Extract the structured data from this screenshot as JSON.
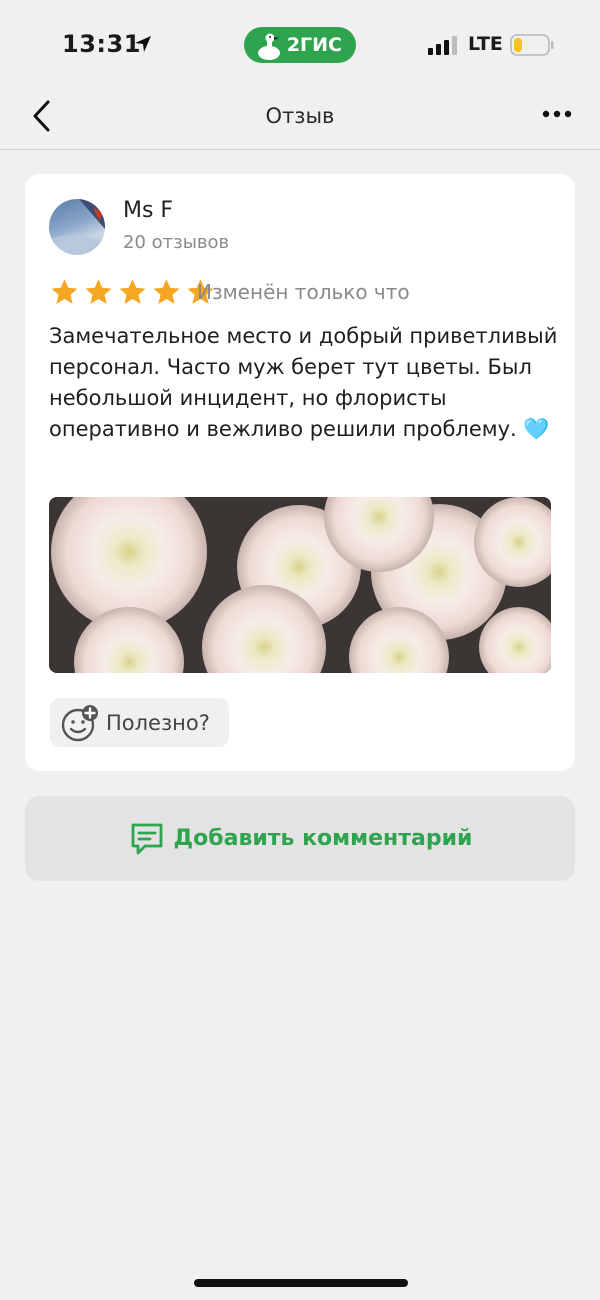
{
  "status_bar": {
    "time": "13:31",
    "app_badge": "2ГИС",
    "network": "LTE",
    "battery_level": 0.25
  },
  "nav": {
    "title": "Отзыв"
  },
  "review": {
    "author": "Ms F",
    "reviews_count": "20 отзывов",
    "rating": 5,
    "max_rating": 5,
    "edited": "Изменён только что",
    "text": "Замечательное место и добрый приветливый персонал. Часто муж берет тут цветы. Был небольшой инцидент, но флористы оперативно и вежливо решили проблему. 🩵",
    "useful_label": "Полезно?"
  },
  "actions": {
    "add_comment_label": "Добавить комментарий"
  },
  "colors": {
    "brand_green": "#2ea44f",
    "star": "#f5a623",
    "background": "#f0f0f0"
  }
}
